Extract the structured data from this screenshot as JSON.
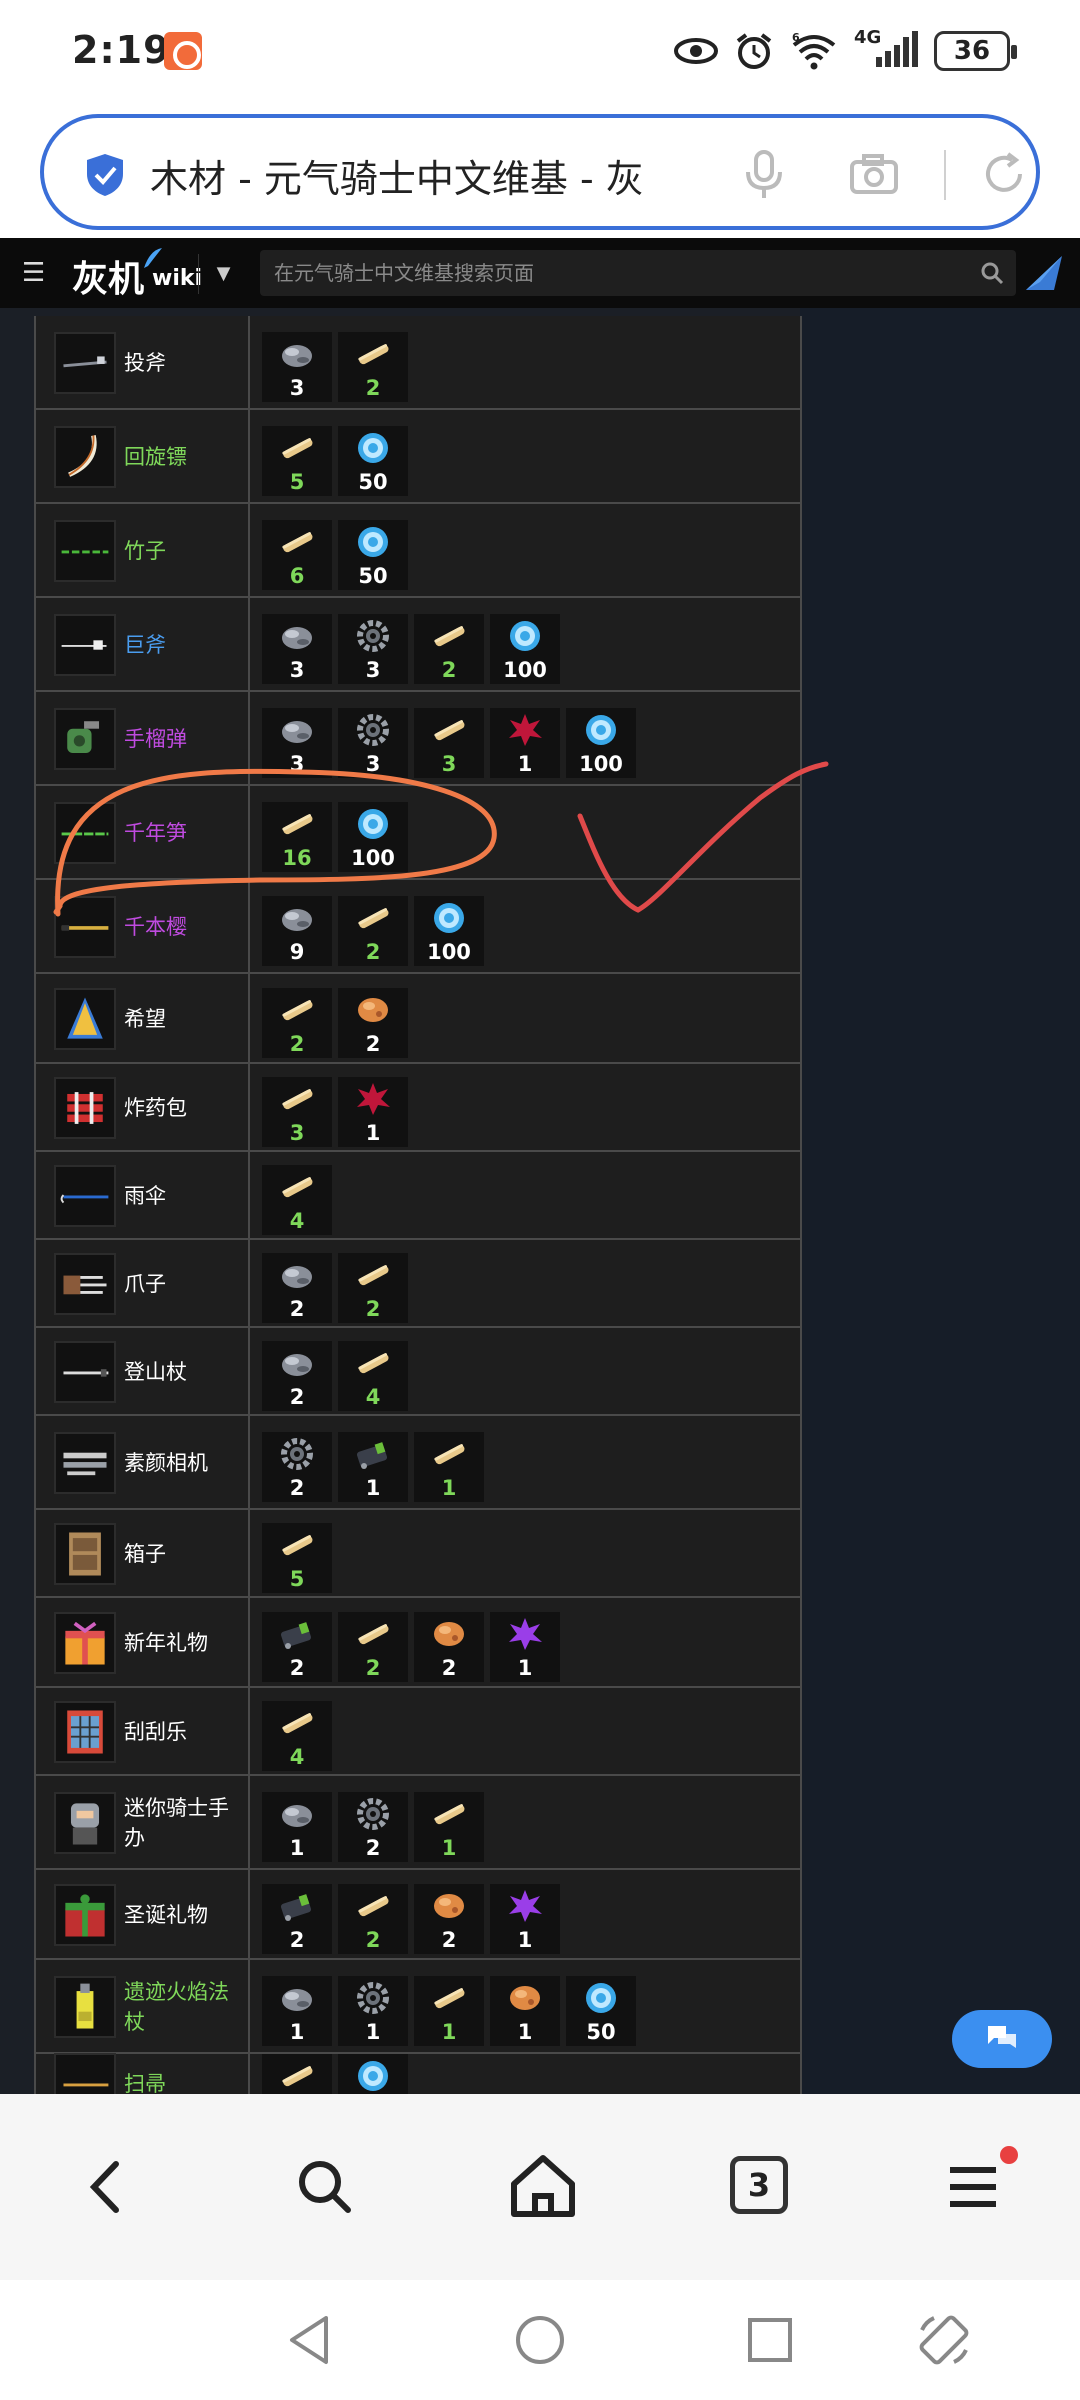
{
  "status_bar": {
    "time": "2:19",
    "network": "4G",
    "wifi_label": "6",
    "battery": "36"
  },
  "address_bar": {
    "title": "木材 - 元气骑士中文维基 - 灰"
  },
  "wiki_header": {
    "logo_text": "灰机",
    "logo_wiki": "wiki",
    "search_placeholder": "在元气骑士中文维基搜索页面"
  },
  "colors": {
    "accent_blue": "#3a6fd8",
    "name_white": "#ffffff",
    "name_green": "#7fd85a",
    "name_blue": "#4a9df0",
    "name_purple": "#c04be0",
    "qty_white": "#ffffff",
    "qty_green": "#7fd85a",
    "annotation_orange": "#f07a48",
    "annotation_red": "#e04a4a"
  },
  "table": {
    "rows": [
      {
        "name": "投斧",
        "name_color": "white",
        "thumb": "throwing-axe-icon",
        "mats": [
          {
            "icon": "stone-icon",
            "qty": "3",
            "qc": "white"
          },
          {
            "icon": "wood-icon",
            "qty": "2",
            "qc": "green"
          }
        ]
      },
      {
        "name": "回旋镖",
        "name_color": "green",
        "thumb": "boomerang-icon",
        "mats": [
          {
            "icon": "wood-icon",
            "qty": "5",
            "qc": "green"
          },
          {
            "icon": "gem-icon",
            "qty": "50",
            "qc": "white"
          }
        ]
      },
      {
        "name": "竹子",
        "name_color": "green",
        "thumb": "bamboo-icon",
        "mats": [
          {
            "icon": "wood-icon",
            "qty": "6",
            "qc": "green"
          },
          {
            "icon": "gem-icon",
            "qty": "50",
            "qc": "white"
          }
        ]
      },
      {
        "name": "巨斧",
        "name_color": "blue",
        "thumb": "giant-axe-icon",
        "mats": [
          {
            "icon": "stone-icon",
            "qty": "3",
            "qc": "white"
          },
          {
            "icon": "gear-icon",
            "qty": "3",
            "qc": "white"
          },
          {
            "icon": "wood-icon",
            "qty": "2",
            "qc": "green"
          },
          {
            "icon": "gem-icon",
            "qty": "100",
            "qc": "white"
          }
        ]
      },
      {
        "name": "手榴弹",
        "name_color": "purple",
        "thumb": "grenade-icon",
        "mats": [
          {
            "icon": "stone-icon",
            "qty": "3",
            "qc": "white"
          },
          {
            "icon": "gear-icon",
            "qty": "3",
            "qc": "white"
          },
          {
            "icon": "wood-icon",
            "qty": "3",
            "qc": "green"
          },
          {
            "icon": "red-leaf-icon",
            "qty": "1",
            "qc": "white"
          },
          {
            "icon": "gem-icon",
            "qty": "100",
            "qc": "white"
          }
        ]
      },
      {
        "name": "千年笋",
        "name_color": "purple",
        "thumb": "bamboo-shoot-icon",
        "mats": [
          {
            "icon": "wood-icon",
            "qty": "16",
            "qc": "green"
          },
          {
            "icon": "gem-icon",
            "qty": "100",
            "qc": "white"
          }
        ]
      },
      {
        "name": "千本樱",
        "name_color": "purple",
        "thumb": "senbonzakura-icon",
        "mats": [
          {
            "icon": "stone-icon",
            "qty": "9",
            "qc": "white"
          },
          {
            "icon": "wood-icon",
            "qty": "2",
            "qc": "green"
          },
          {
            "icon": "gem-icon",
            "qty": "100",
            "qc": "white"
          }
        ]
      },
      {
        "name": "希望",
        "name_color": "white",
        "thumb": "hope-icon",
        "mats": [
          {
            "icon": "wood-icon",
            "qty": "2",
            "qc": "green"
          },
          {
            "icon": "ore-icon",
            "qty": "2",
            "qc": "white"
          }
        ]
      },
      {
        "name": "炸药包",
        "name_color": "white",
        "thumb": "dynamite-icon",
        "mats": [
          {
            "icon": "wood-icon",
            "qty": "3",
            "qc": "green"
          },
          {
            "icon": "red-leaf-icon",
            "qty": "1",
            "qc": "white"
          }
        ]
      },
      {
        "name": "雨伞",
        "name_color": "white",
        "thumb": "umbrella-icon",
        "mats": [
          {
            "icon": "wood-icon",
            "qty": "4",
            "qc": "green"
          }
        ]
      },
      {
        "name": "爪子",
        "name_color": "white",
        "thumb": "claw-icon",
        "mats": [
          {
            "icon": "stone-icon",
            "qty": "2",
            "qc": "white"
          },
          {
            "icon": "wood-icon",
            "qty": "2",
            "qc": "green"
          }
        ]
      },
      {
        "name": "登山杖",
        "name_color": "white",
        "thumb": "trekking-pole-icon",
        "mats": [
          {
            "icon": "stone-icon",
            "qty": "2",
            "qc": "white"
          },
          {
            "icon": "wood-icon",
            "qty": "4",
            "qc": "green"
          }
        ]
      },
      {
        "name": "素颜相机",
        "name_color": "white",
        "thumb": "camera-icon",
        "mats": [
          {
            "icon": "gear-icon",
            "qty": "2",
            "qc": "white"
          },
          {
            "icon": "battery-icon",
            "qty": "1",
            "qc": "white"
          },
          {
            "icon": "wood-icon",
            "qty": "1",
            "qc": "green"
          }
        ]
      },
      {
        "name": "箱子",
        "name_color": "white",
        "thumb": "box-icon",
        "mats": [
          {
            "icon": "wood-icon",
            "qty": "5",
            "qc": "green"
          }
        ]
      },
      {
        "name": "新年礼物",
        "name_color": "white",
        "thumb": "newyear-gift-icon",
        "mats": [
          {
            "icon": "battery-icon",
            "qty": "2",
            "qc": "white"
          },
          {
            "icon": "wood-icon",
            "qty": "2",
            "qc": "green"
          },
          {
            "icon": "ore-icon",
            "qty": "2",
            "qc": "white"
          },
          {
            "icon": "purple-leaf-icon",
            "qty": "1",
            "qc": "white"
          }
        ]
      },
      {
        "name": "刮刮乐",
        "name_color": "white",
        "thumb": "scratch-card-icon",
        "mats": [
          {
            "icon": "wood-icon",
            "qty": "4",
            "qc": "green"
          }
        ]
      },
      {
        "name": "迷你骑士手办",
        "name_color": "white",
        "thumb": "mini-knight-icon",
        "mats": [
          {
            "icon": "stone-icon",
            "qty": "1",
            "qc": "white"
          },
          {
            "icon": "gear-icon",
            "qty": "2",
            "qc": "white"
          },
          {
            "icon": "wood-icon",
            "qty": "1",
            "qc": "green"
          }
        ]
      },
      {
        "name": "圣诞礼物",
        "name_color": "white",
        "thumb": "christmas-gift-icon",
        "mats": [
          {
            "icon": "battery-icon",
            "qty": "2",
            "qc": "white"
          },
          {
            "icon": "wood-icon",
            "qty": "2",
            "qc": "green"
          },
          {
            "icon": "ore-icon",
            "qty": "2",
            "qc": "white"
          },
          {
            "icon": "purple-leaf-icon",
            "qty": "1",
            "qc": "white"
          }
        ]
      },
      {
        "name": "遗迹火焰法杖",
        "name_color": "green",
        "thumb": "relic-staff-icon",
        "mats": [
          {
            "icon": "stone-icon",
            "qty": "1",
            "qc": "white"
          },
          {
            "icon": "gear-icon",
            "qty": "1",
            "qc": "white"
          },
          {
            "icon": "wood-icon",
            "qty": "1",
            "qc": "green"
          },
          {
            "icon": "ore-icon",
            "qty": "1",
            "qc": "white"
          },
          {
            "icon": "gem-icon",
            "qty": "50",
            "qc": "white"
          }
        ]
      },
      {
        "name": "扫帚",
        "name_color": "green",
        "thumb": "broom-icon",
        "mats": [
          {
            "icon": "wood-icon",
            "qty": "",
            "qc": "green"
          },
          {
            "icon": "gem-icon",
            "qty": "",
            "qc": "white"
          }
        ]
      }
    ]
  },
  "browser_nav": {
    "tab_count": "3"
  }
}
